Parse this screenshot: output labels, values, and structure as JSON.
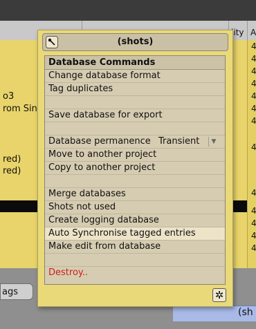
{
  "background": {
    "header_col_ility": "lity",
    "header_col_a": "A",
    "left_texts": [
      "o3",
      "rom Sin",
      "red)",
      "red)"
    ],
    "right_numbers": [
      "4",
      "4",
      "4",
      "4",
      "4",
      "4",
      "4",
      "4",
      "4",
      "4",
      "4",
      "4",
      "4",
      "4",
      "4",
      "4",
      "4"
    ],
    "tab_label": "ags",
    "bottom_text": "(sh"
  },
  "popup": {
    "title": "(shots)",
    "heading": "Database Commands",
    "items": {
      "change_format": "Change database format",
      "tag_duplicates": "Tag duplicates",
      "save_export": "Save database for export",
      "permanence_label": "Database permanence",
      "permanence_value": "Transient",
      "move_project": "Move to another project",
      "copy_project": "Copy to another project",
      "merge": "Merge databases",
      "shots_not_used": "Shots not used",
      "logging_db": "Create logging database",
      "auto_sync": "Auto Synchronise tagged entries",
      "make_edit": "Make edit from database",
      "destroy": "Destroy.."
    },
    "star_button": "✲"
  },
  "colors": {
    "table_yellow": "#e8d46a",
    "popup_bg": "#e9d979",
    "menu_bg": "#d6ccb1",
    "destroy_red": "#cc1f1f",
    "highlight_row": "#ece3c8"
  }
}
